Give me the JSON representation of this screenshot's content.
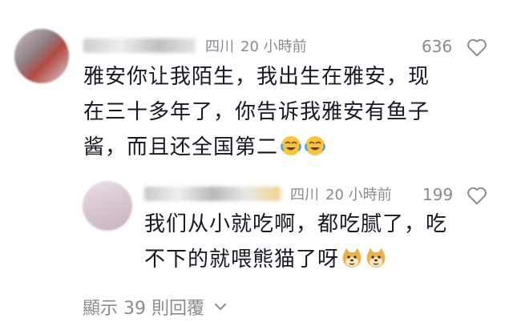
{
  "comment1": {
    "location": "四川",
    "time": "20 小時前",
    "likes": "636",
    "lines": [
      "雅安你让我陌生，我出生在雅安，现",
      "在三十多年了，你告诉我雅安有鱼子",
      "酱，而且还全国第二"
    ]
  },
  "comment2": {
    "location": "四川",
    "time": "20 小時前",
    "likes": "199",
    "lines": [
      "我们从小就吃啊，都吃腻了，吃",
      "不下的就喂熊猫了呀"
    ]
  },
  "show_replies": "顯示 39 則回覆",
  "colors": {
    "text": "#161823",
    "muted": "#8a8b91",
    "heart": "#8a8b91"
  },
  "icons": {
    "heart": "heart-outline-icon",
    "laugh": "laugh-cry-emoji",
    "doge": "doge-emoji",
    "chevron": "chevron-down-icon"
  }
}
